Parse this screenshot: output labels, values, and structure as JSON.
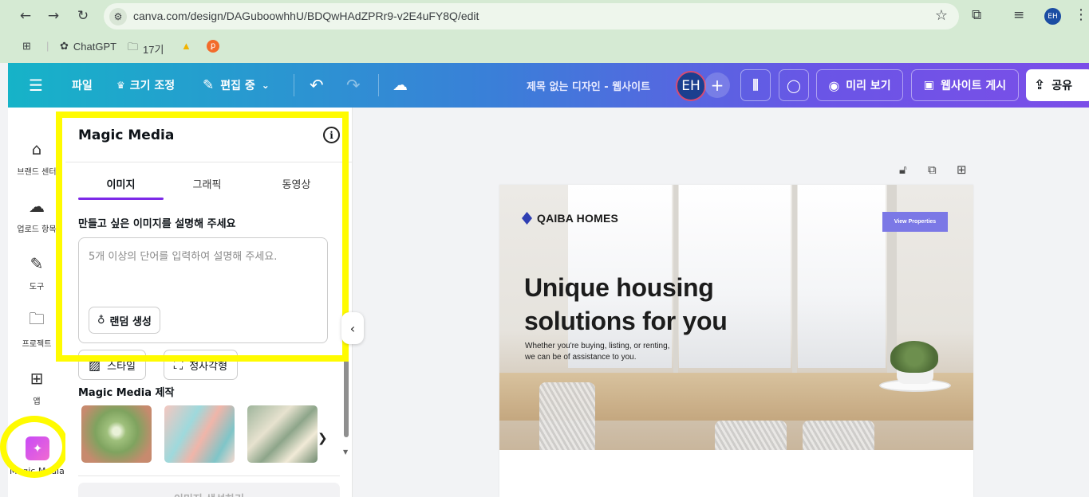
{
  "browser": {
    "url": "canva.com/design/DAGuboowhhU/BDQwHAdZPRr9-v2E4uFY8Q/edit",
    "profile_initials": "EH",
    "bookmarks": [
      {
        "label": "ChatGPT",
        "icon": "chatgpt-icon"
      },
      {
        "label": "17기",
        "icon": "folder-icon"
      },
      {
        "label": "",
        "icon": "drive-icon"
      },
      {
        "label": "",
        "icon": "app-icon"
      }
    ]
  },
  "header": {
    "file": "파일",
    "resize": "크기 조정",
    "editing": "편집 중",
    "title": "제목 없는 디자인 - 웹사이트",
    "avatar": "EH",
    "preview": "미리 보기",
    "publish": "웹사이트 게시",
    "share": "공유"
  },
  "rail": {
    "items": [
      {
        "label": "브랜드 센터",
        "icon": "brand-kit-icon"
      },
      {
        "label": "업로드 항목",
        "icon": "upload-cloud-icon"
      },
      {
        "label": "도구",
        "icon": "draw-tool-icon"
      },
      {
        "label": "프로젝트",
        "icon": "folder-icon"
      },
      {
        "label": "앱",
        "icon": "apps-grid-icon"
      }
    ],
    "magic_media": "Magic Media"
  },
  "panel": {
    "title": "Magic Media",
    "tabs": [
      "이미지",
      "그래픽",
      "동영상"
    ],
    "active_tab": "이미지",
    "prompt_label": "만들고 싶은 이미지를 설명해 주세요",
    "prompt_placeholder": "5개 이상의 단어를 입력하여 설명해 주세요.",
    "random": "랜덤 생성",
    "style": "스타일",
    "aspect": "정사각형",
    "section": "Magic Media 제작",
    "generate": "이미지 생성하기"
  },
  "design": {
    "brand": "QAIBA HOMES",
    "cta": "View Properties",
    "headline_1": "Unique housing",
    "headline_2": "solutions for you",
    "sub_1": "Whether you're buying, listing, or renting,",
    "sub_2": "we can be of assistance to you."
  },
  "colors": {
    "accent_purple": "#7d2ae8",
    "highlight_yellow": "#fffb00",
    "cta_button": "#7b78e6"
  }
}
